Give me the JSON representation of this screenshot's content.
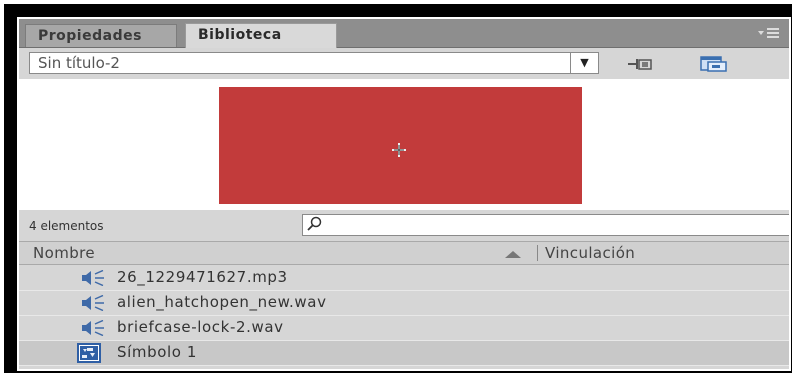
{
  "tabs": [
    {
      "label": "Propiedades",
      "active": false
    },
    {
      "label": "Biblioteca",
      "active": true
    }
  ],
  "document": {
    "selected": "Sin título-2",
    "arrow": "▼"
  },
  "preview": {
    "swatch_color": "#c23b3b"
  },
  "library": {
    "count_label": "4 elementos",
    "search": {
      "value": ""
    },
    "columns": {
      "name": "Nombre",
      "linkage": "Vinculación"
    },
    "items": [
      {
        "label": "26_1229471627.mp3",
        "icon": "sound-icon"
      },
      {
        "label": "alien_hatchopen_new.wav",
        "icon": "sound-icon"
      },
      {
        "label": "briefcase-lock-2.wav",
        "icon": "sound-icon"
      },
      {
        "label": "Símbolo 1",
        "icon": "movieclip-symbol-icon"
      }
    ]
  }
}
